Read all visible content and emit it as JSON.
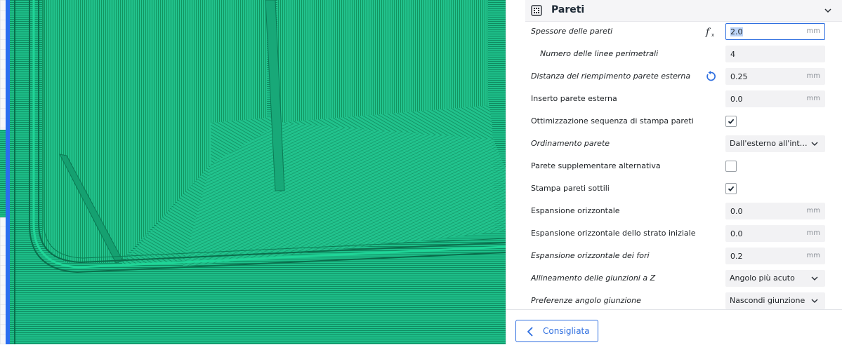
{
  "section": {
    "title": "Pareti",
    "icon": "wall-grid-icon"
  },
  "settings": [
    {
      "label": "Spessore delle pareti",
      "italic": true,
      "type": "number",
      "value": "2.0",
      "unit": "mm",
      "active": true,
      "icon": "function-icon"
    },
    {
      "label": "Numero delle linee perimetrali",
      "italic": true,
      "indent": true,
      "type": "number",
      "value": "4",
      "unit": ""
    },
    {
      "label": "Distanza del riempimento parete esterna",
      "italic": true,
      "type": "number",
      "value": "0.25",
      "unit": "mm",
      "icon": "reset-icon"
    },
    {
      "label": "Inserto parete esterna",
      "type": "number",
      "value": "0.0",
      "unit": "mm"
    },
    {
      "label": "Ottimizzazione sequenza di stampa pareti",
      "type": "checkbox",
      "checked": true
    },
    {
      "label": "Ordinamento parete",
      "italic": true,
      "type": "dropdown",
      "value": "Dall'esterno all'interno"
    },
    {
      "label": "Parete supplementare alternativa",
      "type": "checkbox",
      "checked": false
    },
    {
      "label": "Stampa pareti sottili",
      "type": "checkbox",
      "checked": true
    },
    {
      "label": "Espansione orizzontale",
      "type": "number",
      "value": "0.0",
      "unit": "mm"
    },
    {
      "label": "Espansione orizzontale dello strato iniziale",
      "type": "number",
      "value": "0.0",
      "unit": "mm"
    },
    {
      "label": "Espansione orizzontale dei fori",
      "italic": true,
      "type": "number",
      "value": "0.2",
      "unit": "mm"
    },
    {
      "label": "Allineamento delle giunzioni a Z",
      "italic": true,
      "type": "dropdown",
      "value": "Angolo più acuto"
    },
    {
      "label": "Preferenze angolo giunzione",
      "italic": true,
      "type": "dropdown",
      "value": "Nascondi giunzione"
    }
  ],
  "footer": {
    "button_label": "Consigliata"
  },
  "colors": {
    "accent": "#2f6fe0",
    "layer_green": "#1ec08a"
  }
}
